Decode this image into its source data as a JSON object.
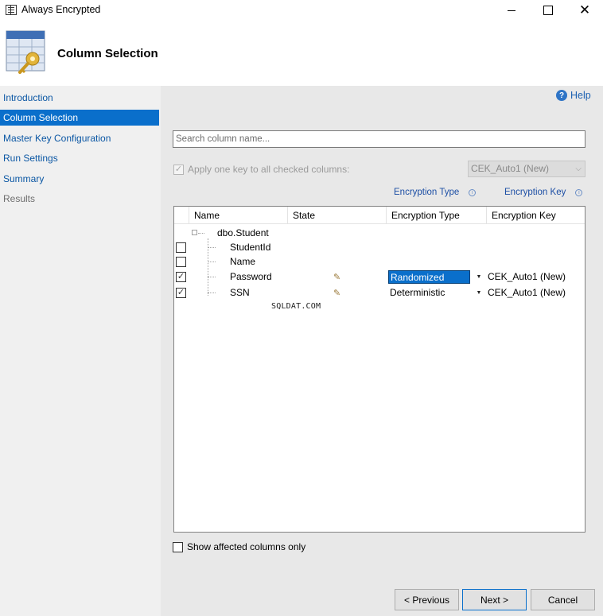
{
  "window": {
    "title": "Always Encrypted",
    "icon": "table-icon",
    "minimize_label": "",
    "maximize_label": "",
    "close_label": "✕"
  },
  "header": {
    "heading": "Column Selection",
    "icon": "key-table-icon"
  },
  "sidebar": {
    "items": [
      {
        "label": "Introduction",
        "state": "link"
      },
      {
        "label": "Column Selection",
        "state": "active"
      },
      {
        "label": "Master Key Configuration",
        "state": "link"
      },
      {
        "label": "Run Settings",
        "state": "link"
      },
      {
        "label": "Summary",
        "state": "link"
      },
      {
        "label": "Results",
        "state": "disabled"
      }
    ]
  },
  "help": {
    "label": "Help",
    "icon": "help-icon"
  },
  "search": {
    "placeholder": "Search column name...",
    "value": ""
  },
  "apply_one_key": {
    "label": "Apply one key to all checked columns:",
    "checked": true,
    "enabled": false,
    "selected_key": "CEK_Auto1 (New)"
  },
  "legend": {
    "encryption_type": "Encryption Type",
    "encryption_key": "Encryption Key"
  },
  "grid": {
    "columns": [
      "Name",
      "State",
      "Encryption Type",
      "Encryption Key"
    ],
    "table_node": "dbo.Student",
    "rows": [
      {
        "name": "StudentId",
        "checked": false,
        "state": "",
        "type": "",
        "key": ""
      },
      {
        "name": "Name",
        "checked": false,
        "state": "",
        "type": "",
        "key": ""
      },
      {
        "name": "Password",
        "checked": true,
        "state": "pencil-icon",
        "type": "Randomized",
        "key": "CEK_Auto1 (New)",
        "type_selected": true
      },
      {
        "name": "SSN",
        "checked": true,
        "state": "pencil-icon",
        "type": "Deterministic",
        "key": "CEK_Auto1 (New)",
        "type_selected": false
      }
    ],
    "watermark": "SQLDAT.COM"
  },
  "show_affected": {
    "label": "Show affected columns only",
    "checked": false
  },
  "footer": {
    "previous": "< Previous",
    "next": "Next >",
    "cancel": "Cancel"
  },
  "colors": {
    "accent": "#0a6fcb",
    "link": "#0b57a4",
    "sidebar_bg": "#f0f0f0",
    "content_bg": "#e8e8e8"
  }
}
